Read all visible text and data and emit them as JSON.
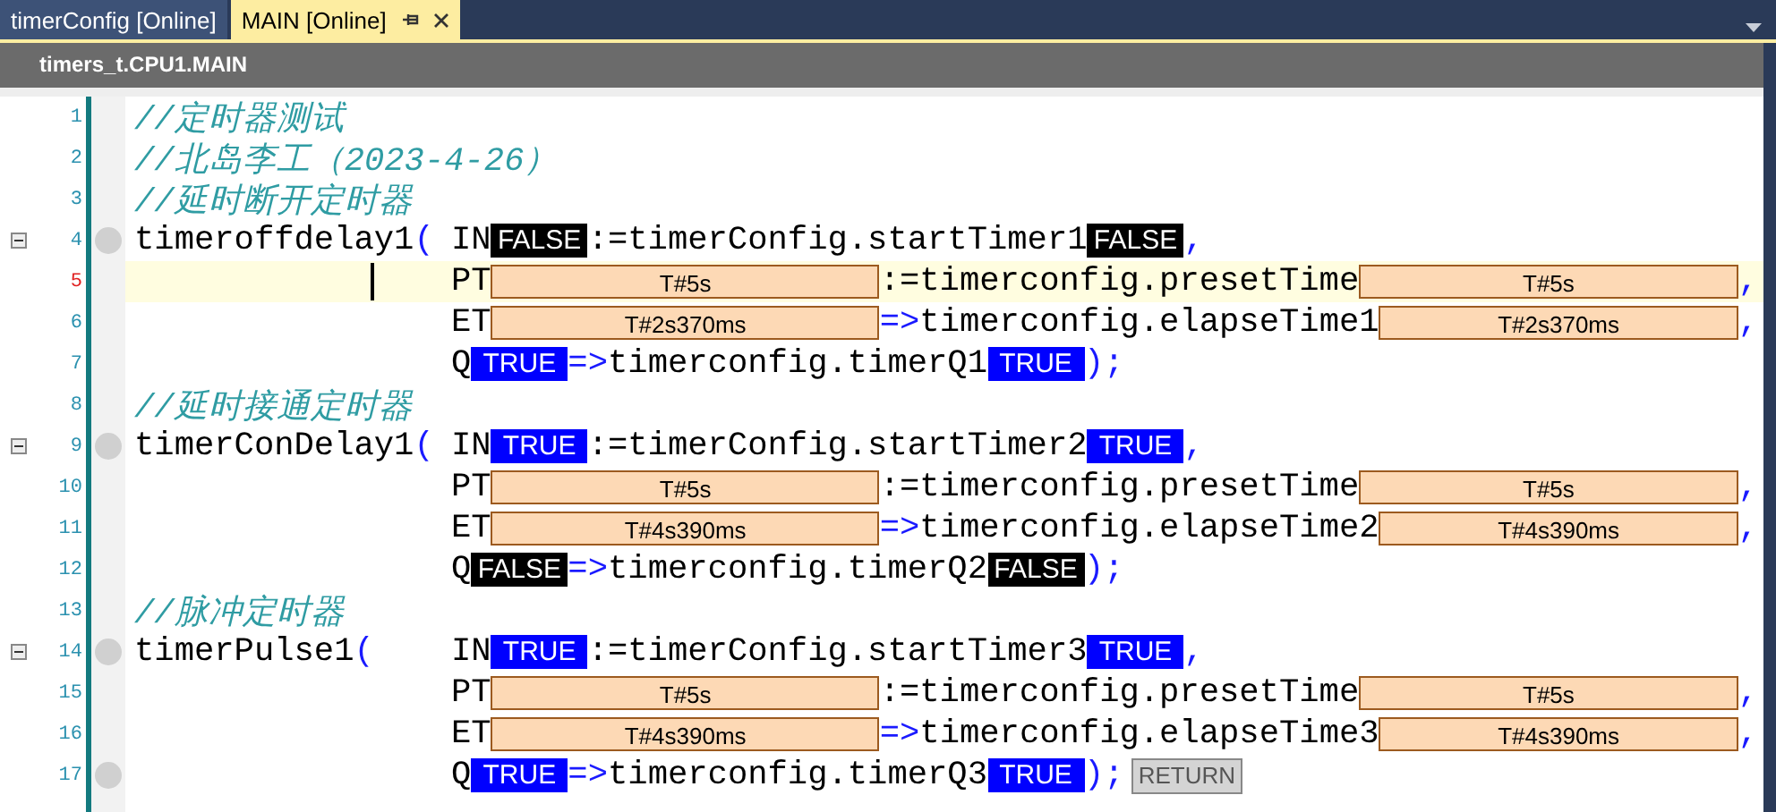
{
  "tabs": [
    {
      "label": "timerConfig [Online]",
      "selected": false
    },
    {
      "label": "MAIN [Online]",
      "selected": true
    }
  ],
  "header": {
    "title": "timers_t.CPU1.MAIN"
  },
  "lines": [
    {
      "number": "1",
      "foldable": false,
      "breakpoint": false,
      "current": false,
      "comment": "//定时器测试"
    },
    {
      "number": "2",
      "foldable": false,
      "breakpoint": false,
      "current": false,
      "comment": "//北岛李工（2023-4-26）"
    },
    {
      "number": "3",
      "foldable": false,
      "breakpoint": false,
      "current": false,
      "comment": "//延时断开定时器"
    },
    {
      "number": "4",
      "foldable": true,
      "breakpoint": true,
      "current": false,
      "head": [
        {
          "kind": "name",
          "text": "timeroffdelay1"
        },
        {
          "kind": "op",
          "text": "("
        }
      ],
      "body": [
        {
          "kind": "name",
          "text": "IN"
        },
        {
          "kind": "bool",
          "text": "FALSE",
          "on": false
        },
        {
          "kind": "name",
          "text": ":=timerConfig.startTimer1"
        },
        {
          "kind": "bool",
          "text": "FALSE",
          "on": false
        },
        {
          "kind": "op",
          "text": ","
        }
      ]
    },
    {
      "number": "5",
      "foldable": false,
      "breakpoint": false,
      "current": true,
      "body": [
        {
          "kind": "name",
          "text": "PT"
        },
        {
          "kind": "time",
          "text": "T#5s"
        },
        {
          "kind": "name",
          "text": ":=timerconfig.presetTime"
        },
        {
          "kind": "time",
          "text": "T#5s"
        },
        {
          "kind": "op",
          "text": ","
        }
      ]
    },
    {
      "number": "6",
      "foldable": false,
      "breakpoint": false,
      "current": false,
      "body": [
        {
          "kind": "name",
          "text": "ET"
        },
        {
          "kind": "time",
          "text": "T#2s370ms"
        },
        {
          "kind": "op",
          "text": "=>"
        },
        {
          "kind": "name",
          "text": "timerconfig.elapseTime1"
        },
        {
          "kind": "time",
          "text": "T#2s370ms"
        },
        {
          "kind": "op",
          "text": ","
        }
      ]
    },
    {
      "number": "7",
      "foldable": false,
      "breakpoint": false,
      "current": false,
      "body": [
        {
          "kind": "name",
          "text": "Q"
        },
        {
          "kind": "bool",
          "text": "TRUE",
          "on": true
        },
        {
          "kind": "op",
          "text": "=>"
        },
        {
          "kind": "name",
          "text": "timerconfig.timerQ1"
        },
        {
          "kind": "bool",
          "text": "TRUE",
          "on": true
        },
        {
          "kind": "op",
          "text": ");"
        }
      ]
    },
    {
      "number": "8",
      "foldable": false,
      "breakpoint": false,
      "current": false,
      "comment": "//延时接通定时器"
    },
    {
      "number": "9",
      "foldable": true,
      "breakpoint": true,
      "current": false,
      "head": [
        {
          "kind": "name",
          "text": "timerConDelay1"
        },
        {
          "kind": "op",
          "text": "("
        }
      ],
      "body": [
        {
          "kind": "name",
          "text": "IN"
        },
        {
          "kind": "bool",
          "text": "TRUE",
          "on": true
        },
        {
          "kind": "name",
          "text": ":=timerConfig.startTimer2"
        },
        {
          "kind": "bool",
          "text": "TRUE",
          "on": true
        },
        {
          "kind": "op",
          "text": ","
        }
      ]
    },
    {
      "number": "10",
      "foldable": false,
      "breakpoint": false,
      "current": false,
      "body": [
        {
          "kind": "name",
          "text": "PT"
        },
        {
          "kind": "time",
          "text": "T#5s"
        },
        {
          "kind": "name",
          "text": ":=timerconfig.presetTime"
        },
        {
          "kind": "time",
          "text": "T#5s"
        },
        {
          "kind": "op",
          "text": ","
        }
      ]
    },
    {
      "number": "11",
      "foldable": false,
      "breakpoint": false,
      "current": false,
      "body": [
        {
          "kind": "name",
          "text": "ET"
        },
        {
          "kind": "time",
          "text": "T#4s390ms"
        },
        {
          "kind": "op",
          "text": "=>"
        },
        {
          "kind": "name",
          "text": "timerconfig.elapseTime2"
        },
        {
          "kind": "time",
          "text": "T#4s390ms"
        },
        {
          "kind": "op",
          "text": ","
        }
      ]
    },
    {
      "number": "12",
      "foldable": false,
      "breakpoint": false,
      "current": false,
      "body": [
        {
          "kind": "name",
          "text": "Q"
        },
        {
          "kind": "bool",
          "text": "FALSE",
          "on": false
        },
        {
          "kind": "op",
          "text": "=>"
        },
        {
          "kind": "name",
          "text": "timerconfig.timerQ2"
        },
        {
          "kind": "bool",
          "text": "FALSE",
          "on": false
        },
        {
          "kind": "op",
          "text": ");"
        }
      ]
    },
    {
      "number": "13",
      "foldable": false,
      "breakpoint": false,
      "current": false,
      "comment": "//脉冲定时器"
    },
    {
      "number": "14",
      "foldable": true,
      "breakpoint": true,
      "current": false,
      "head": [
        {
          "kind": "name",
          "text": "timerPulse1"
        },
        {
          "kind": "op",
          "text": "("
        }
      ],
      "body": [
        {
          "kind": "name",
          "text": "IN"
        },
        {
          "kind": "bool",
          "text": "TRUE",
          "on": true
        },
        {
          "kind": "name",
          "text": ":=timerConfig.startTimer3"
        },
        {
          "kind": "bool",
          "text": "TRUE",
          "on": true
        },
        {
          "kind": "op",
          "text": ","
        }
      ]
    },
    {
      "number": "15",
      "foldable": false,
      "breakpoint": false,
      "current": false,
      "body": [
        {
          "kind": "name",
          "text": "PT"
        },
        {
          "kind": "time",
          "text": "T#5s"
        },
        {
          "kind": "name",
          "text": ":=timerconfig.presetTime"
        },
        {
          "kind": "time",
          "text": "T#5s"
        },
        {
          "kind": "op",
          "text": ","
        }
      ]
    },
    {
      "number": "16",
      "foldable": false,
      "breakpoint": false,
      "current": false,
      "body": [
        {
          "kind": "name",
          "text": "ET"
        },
        {
          "kind": "time",
          "text": "T#4s390ms"
        },
        {
          "kind": "op",
          "text": "=>"
        },
        {
          "kind": "name",
          "text": "timerconfig.elapseTime3"
        },
        {
          "kind": "time",
          "text": "T#4s390ms"
        },
        {
          "kind": "op",
          "text": ","
        }
      ]
    },
    {
      "number": "17",
      "foldable": false,
      "breakpoint": true,
      "current": false,
      "body": [
        {
          "kind": "name",
          "text": "Q"
        },
        {
          "kind": "bool",
          "text": "TRUE",
          "on": true
        },
        {
          "kind": "op",
          "text": "=>"
        },
        {
          "kind": "name",
          "text": "timerconfig.timerQ3"
        },
        {
          "kind": "bool",
          "text": "TRUE",
          "on": true
        },
        {
          "kind": "op",
          "text": ");"
        },
        {
          "kind": "return",
          "text": "RETURN"
        }
      ]
    }
  ]
}
